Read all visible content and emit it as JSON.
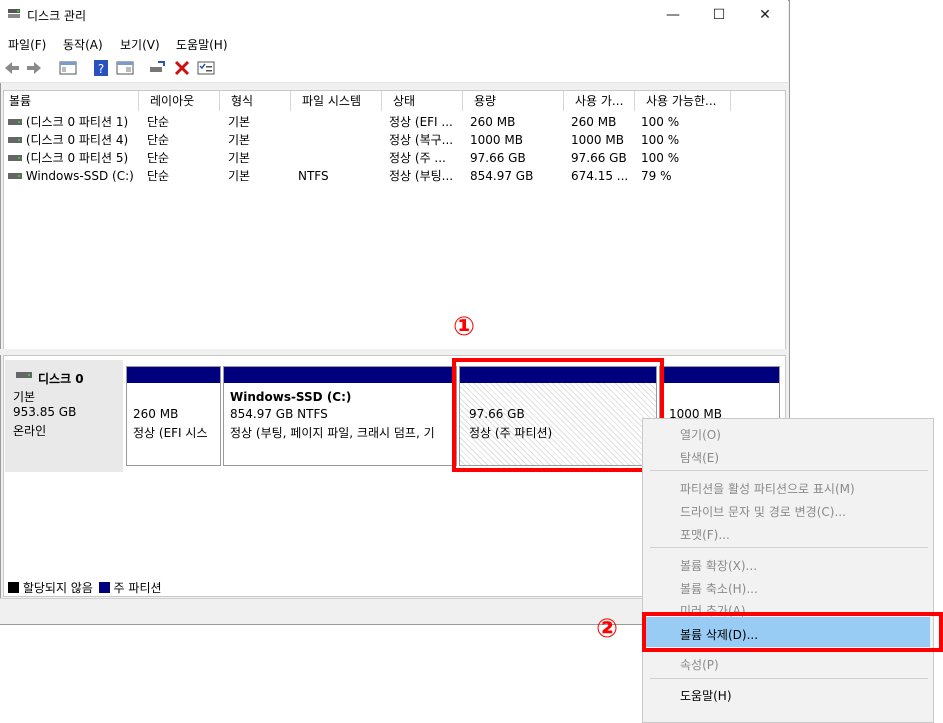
{
  "window": {
    "title": "디스크 관리",
    "minimize": "—",
    "maximize": "☐",
    "close": "✕"
  },
  "menu": [
    "파일(F)",
    "동작(A)",
    "보기(V)",
    "도움말(H)"
  ],
  "columns": [
    "볼륨",
    "레이아웃",
    "형식",
    "파일 시스템",
    "상태",
    "용량",
    "사용 가...",
    "사용 가능한..."
  ],
  "rows": [
    [
      "(디스크 0 파티션 1)",
      "단순",
      "기본",
      "",
      "정상 (EFI ...",
      "260 MB",
      "260 MB",
      "100 %"
    ],
    [
      "(디스크 0 파티션 4)",
      "단순",
      "기본",
      "",
      "정상 (복구...",
      "1000 MB",
      "1000 MB",
      "100 %"
    ],
    [
      "(디스크 0 파티션 5)",
      "단순",
      "기본",
      "",
      "정상 (주 ...",
      "97.66 GB",
      "97.66 GB",
      "100 %"
    ],
    [
      "Windows-SSD (C:)",
      "단순",
      "기본",
      "NTFS",
      "정상 (부팅...",
      "854.97 GB",
      "674.15 ...",
      "79 %"
    ]
  ],
  "disk": {
    "name": "디스크 0",
    "type": "기본",
    "size": "953.85 GB",
    "status": "온라인"
  },
  "partitions": {
    "p1": {
      "size": "260 MB",
      "status": "정상 (EFI 시스"
    },
    "p2": {
      "name": "Windows-SSD  (C:)",
      "size": "854.97 GB NTFS",
      "status": "정상 (부팅, 페이지 파일, 크래시 덤프, 기"
    },
    "p3": {
      "size": "97.66 GB",
      "status": "정상 (주 파티션)"
    },
    "p4": {
      "size": "1000 MB"
    }
  },
  "legend": {
    "unallocated": "할당되지 않음",
    "primary": "주 파티션"
  },
  "context_menu": {
    "open": "열기(O)",
    "explore": "탐색(E)",
    "mark_active": "파티션을 활성 파티션으로 표시(M)",
    "change_letter": "드라이브 문자 및 경로 변경(C)...",
    "format": "포맷(F)...",
    "extend": "볼륨 확장(X)...",
    "shrink": "볼륨 축소(H)...",
    "mirror": "미러 추가(A)...",
    "delete": "볼륨 삭제(D)...",
    "properties": "속성(P)",
    "help": "도움말(H)"
  },
  "annotations": {
    "one": "①",
    "two": "②"
  },
  "colors": {
    "primary_partition": "#00007f",
    "highlight": "#99ccf5",
    "annotation": "#ff0000"
  }
}
